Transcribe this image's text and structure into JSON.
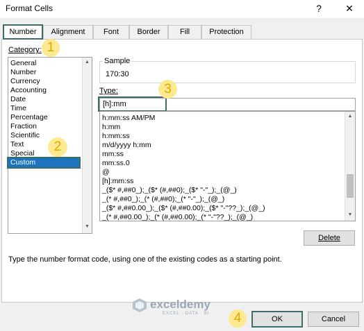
{
  "window": {
    "title": "Format Cells",
    "help": "?",
    "close": "✕"
  },
  "tabs": [
    "Number",
    "Alignment",
    "Font",
    "Border",
    "Fill",
    "Protection"
  ],
  "category": {
    "label": "Category:",
    "items": [
      "General",
      "Number",
      "Currency",
      "Accounting",
      "Date",
      "Time",
      "Percentage",
      "Fraction",
      "Scientific",
      "Text",
      "Special",
      "Custom"
    ],
    "selected": "Custom"
  },
  "sample": {
    "label": "Sample",
    "value": "170:30"
  },
  "type": {
    "label": "Type:",
    "value": "[h]:mm"
  },
  "formats": [
    "h:mm:ss AM/PM",
    "h:mm",
    "h:mm:ss",
    "m/d/yyyy h:mm",
    "mm:ss",
    "mm:ss.0",
    "@",
    "[h]:mm:ss",
    "_($* #,##0_);_($* (#,##0);_($* \"-\"_);_(@_)",
    "_(* #,##0_);_(* (#,##0);_(* \"-\"_);_(@_)",
    "_($* #,##0.00_);_($* (#,##0.00);_($* \"-\"??_);_(@_)",
    "_(* #,##0.00_);_(* (#,##0.00);_(* \"-\"??_);_(@_)"
  ],
  "delete_label": "Delete",
  "hint": "Type the number format code, using one of the existing codes as a starting point.",
  "ok_label": "OK",
  "cancel_label": "Cancel",
  "watermark": {
    "name": "exceldemy",
    "tagline": "EXCEL · DATA · BI"
  },
  "badges": [
    "1",
    "2",
    "3",
    "4"
  ],
  "colors": {
    "selection": "#1e73be",
    "highlight_border": "#3b6d68",
    "badge_fill": "#fde98f",
    "badge_text": "#e0a800"
  }
}
